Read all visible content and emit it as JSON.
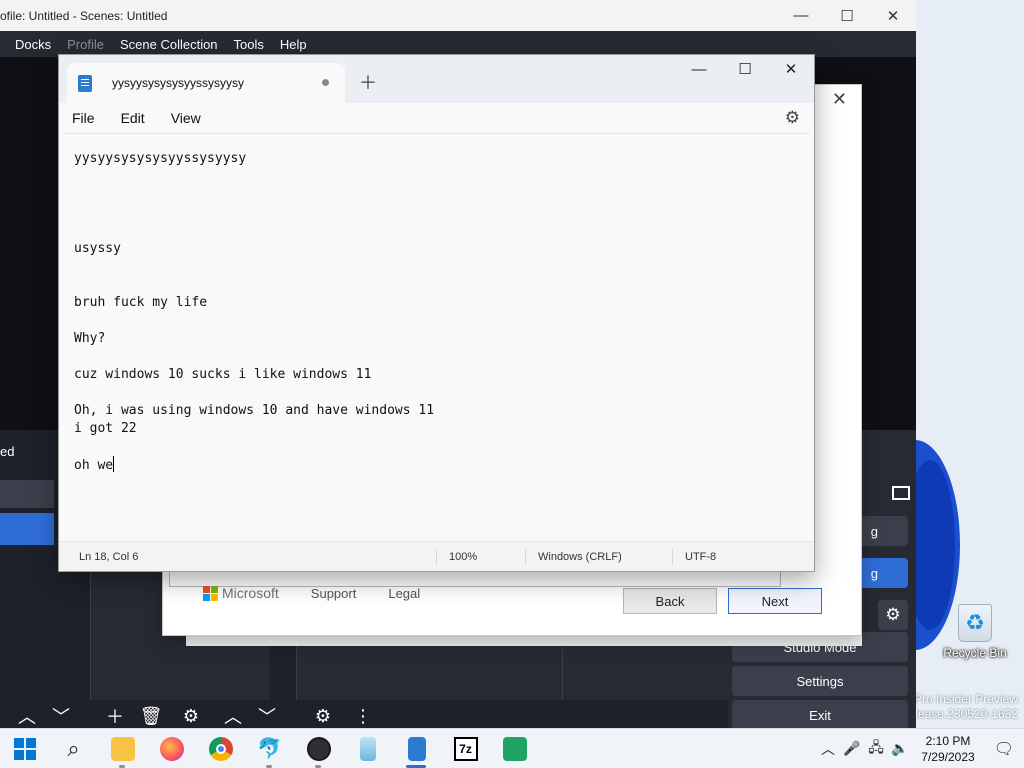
{
  "desktop": {
    "recycle_bin_label": "Recycle Bin",
    "watermark_line1": "Pro Insider Preview",
    "watermark_line2": "release.230520-1632"
  },
  "obs": {
    "title": "ofile: Untitled - Scenes: Untitled",
    "menu": [
      "Docks",
      "Profile",
      "Scene Collection",
      "Tools",
      "Help"
    ],
    "partial_label": "ed",
    "controls": {
      "studio_mode": "Studio Mode",
      "settings": "Settings",
      "exit": "Exit",
      "partial1": "g",
      "partial2": "g"
    }
  },
  "setup_dialog": {
    "brand": "Microsoft",
    "support": "Support",
    "legal": "Legal",
    "back": "Back",
    "next": "Next"
  },
  "notepad": {
    "tab_title": "yysyysysysysyyssysyysy",
    "menu": {
      "file": "File",
      "edit": "Edit",
      "view": "View"
    },
    "lines": [
      "yysyysysysysyyssysyysy",
      "",
      "",
      "",
      "",
      "usyssy",
      "",
      "",
      "bruh fuck my life",
      "",
      "Why?",
      "",
      "cuz windows 10 sucks i like windows 11",
      "",
      "Oh, i was using windows 10 and have windows 11",
      "i got 22",
      "",
      "oh we"
    ],
    "status": {
      "position": "Ln 18, Col 6",
      "zoom": "100%",
      "line_ending": "Windows (CRLF)",
      "encoding": "UTF-8"
    }
  },
  "taskbar": {
    "apps": [
      "start",
      "search",
      "file-explorer",
      "firefox",
      "chrome",
      "dolphin",
      "obs-studio",
      "tablet-app",
      "notepad",
      "7-zip",
      "excel-green"
    ],
    "seven_zip_label": "7z",
    "clock_time": "2:10 PM",
    "clock_date": "7/29/2023"
  },
  "colors": {
    "obs_bg": "#1e2129",
    "accent": "#2f6dd6",
    "notepad_bg": "#f9f9f9"
  }
}
